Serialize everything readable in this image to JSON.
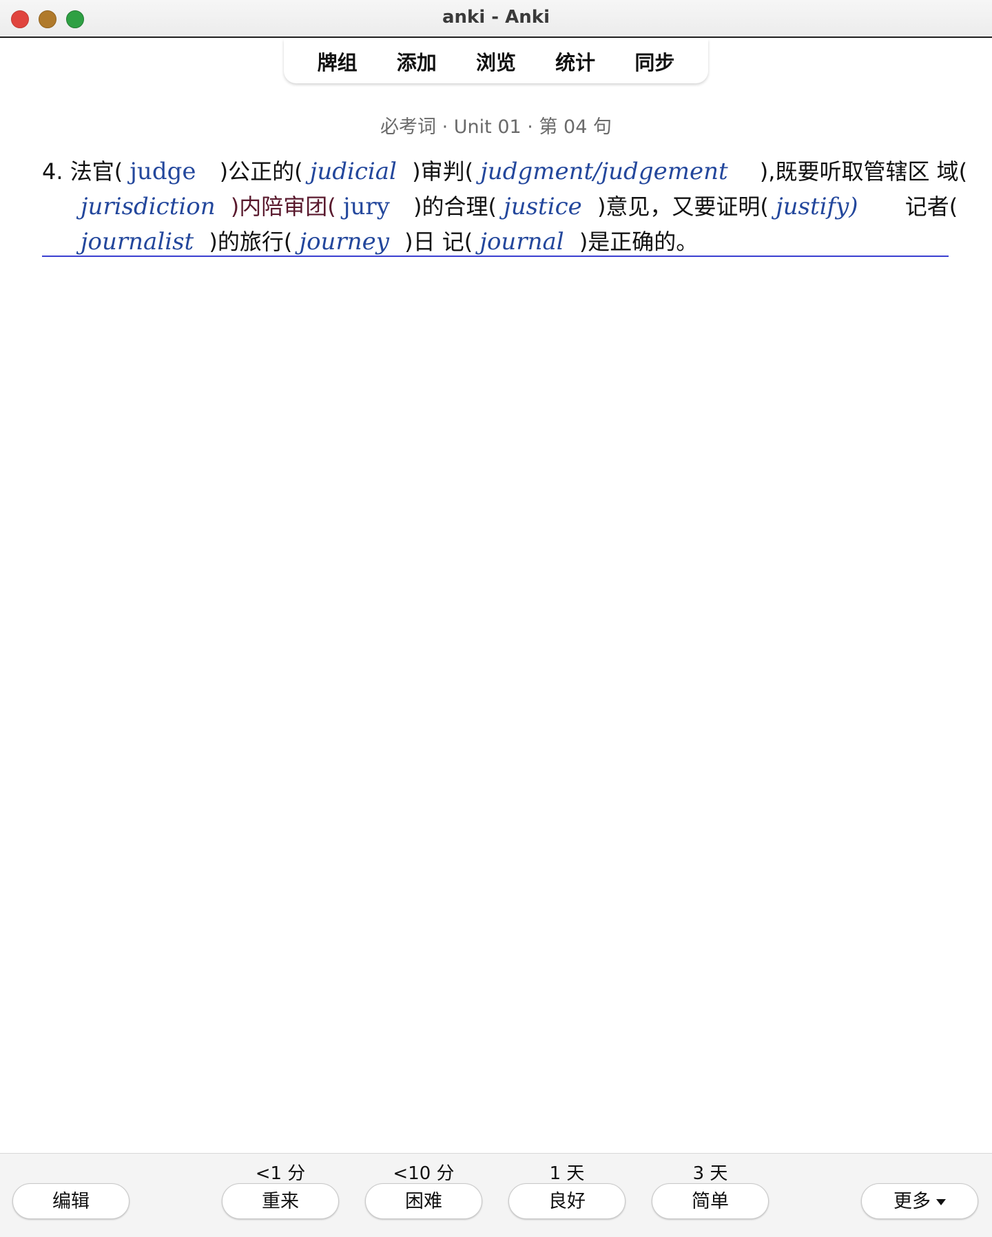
{
  "window": {
    "title": "anki - Anki"
  },
  "toolbar": {
    "items": [
      "牌组",
      "添加",
      "浏览",
      "统计",
      "同步"
    ]
  },
  "card": {
    "deck_info": "必考词 · Unit 01 · 第 04 句",
    "sentence": {
      "number": "4.",
      "line1": {
        "t1": "法官(",
        "w1": "judge",
        "t2": ")公正的(",
        "w2": "judicial",
        "t3": ")审判(",
        "w3": "judgment/judgement",
        "t4": "),既要听取管辖区 域("
      },
      "line2": {
        "w1": "jurisdiction",
        "t1": ")内陪审团(",
        "w2": "jury",
        "t2": ")的合理(",
        "w3": "justice",
        "t3": ")意见，又要证明(",
        "w4": "justify)",
        "t4": "记者("
      },
      "line3": {
        "w1": "journalist",
        "t1": ")的旅行(",
        "w2": "journey",
        "t2": ")日 记(",
        "w3": "journal",
        "t3": ")是正确的。"
      }
    }
  },
  "bottom": {
    "edit_label": "编辑",
    "more_label": "更多",
    "intervals": {
      "again": "<1 分",
      "hard": "<10 分",
      "good": "1 天",
      "easy": "3 天"
    },
    "buttons": {
      "again": "重来",
      "hard": "困难",
      "good": "良好",
      "easy": "简单"
    }
  },
  "colors": {
    "english_word": "#23479c",
    "rule_line": "#3a3fd0",
    "maroon_text": "#5a1a2e",
    "close": "#e0443e",
    "minimize": "#b07a2b",
    "zoom": "#2ea043"
  },
  "icons": [
    "close-icon",
    "minimize-icon",
    "zoom-icon",
    "chevron-down-icon"
  ]
}
